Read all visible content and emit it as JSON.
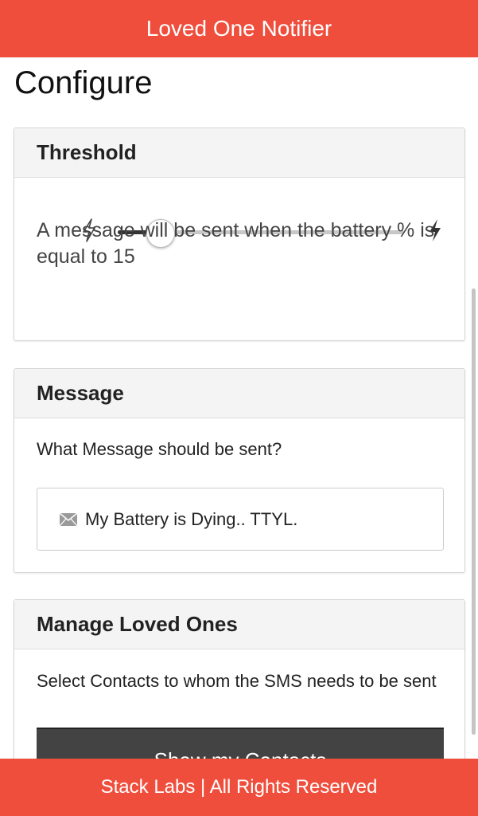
{
  "app": {
    "title": "Loved One Notifier"
  },
  "page": {
    "title": "Configure"
  },
  "threshold": {
    "header": "Threshold",
    "slider_value": 15,
    "slider_min": 0,
    "slider_max": 100,
    "description": "A message will be sent when the battery % is equal to 15",
    "min_icon": "bolt-outline-icon",
    "max_icon": "bolt-filled-icon"
  },
  "message": {
    "header": "Message",
    "question": "What Message should be sent?",
    "input_value": "My Battery is Dying.. TTYL.",
    "input_icon": "envelope-icon"
  },
  "manage": {
    "header": "Manage Loved Ones",
    "description": "Select Contacts to whom the SMS needs to be sent",
    "button_label": "Show my Contacts"
  },
  "footer": {
    "text": "Stack Labs | All Rights Reserved"
  },
  "colors": {
    "accent": "#f04e3c",
    "button": "#434343"
  }
}
